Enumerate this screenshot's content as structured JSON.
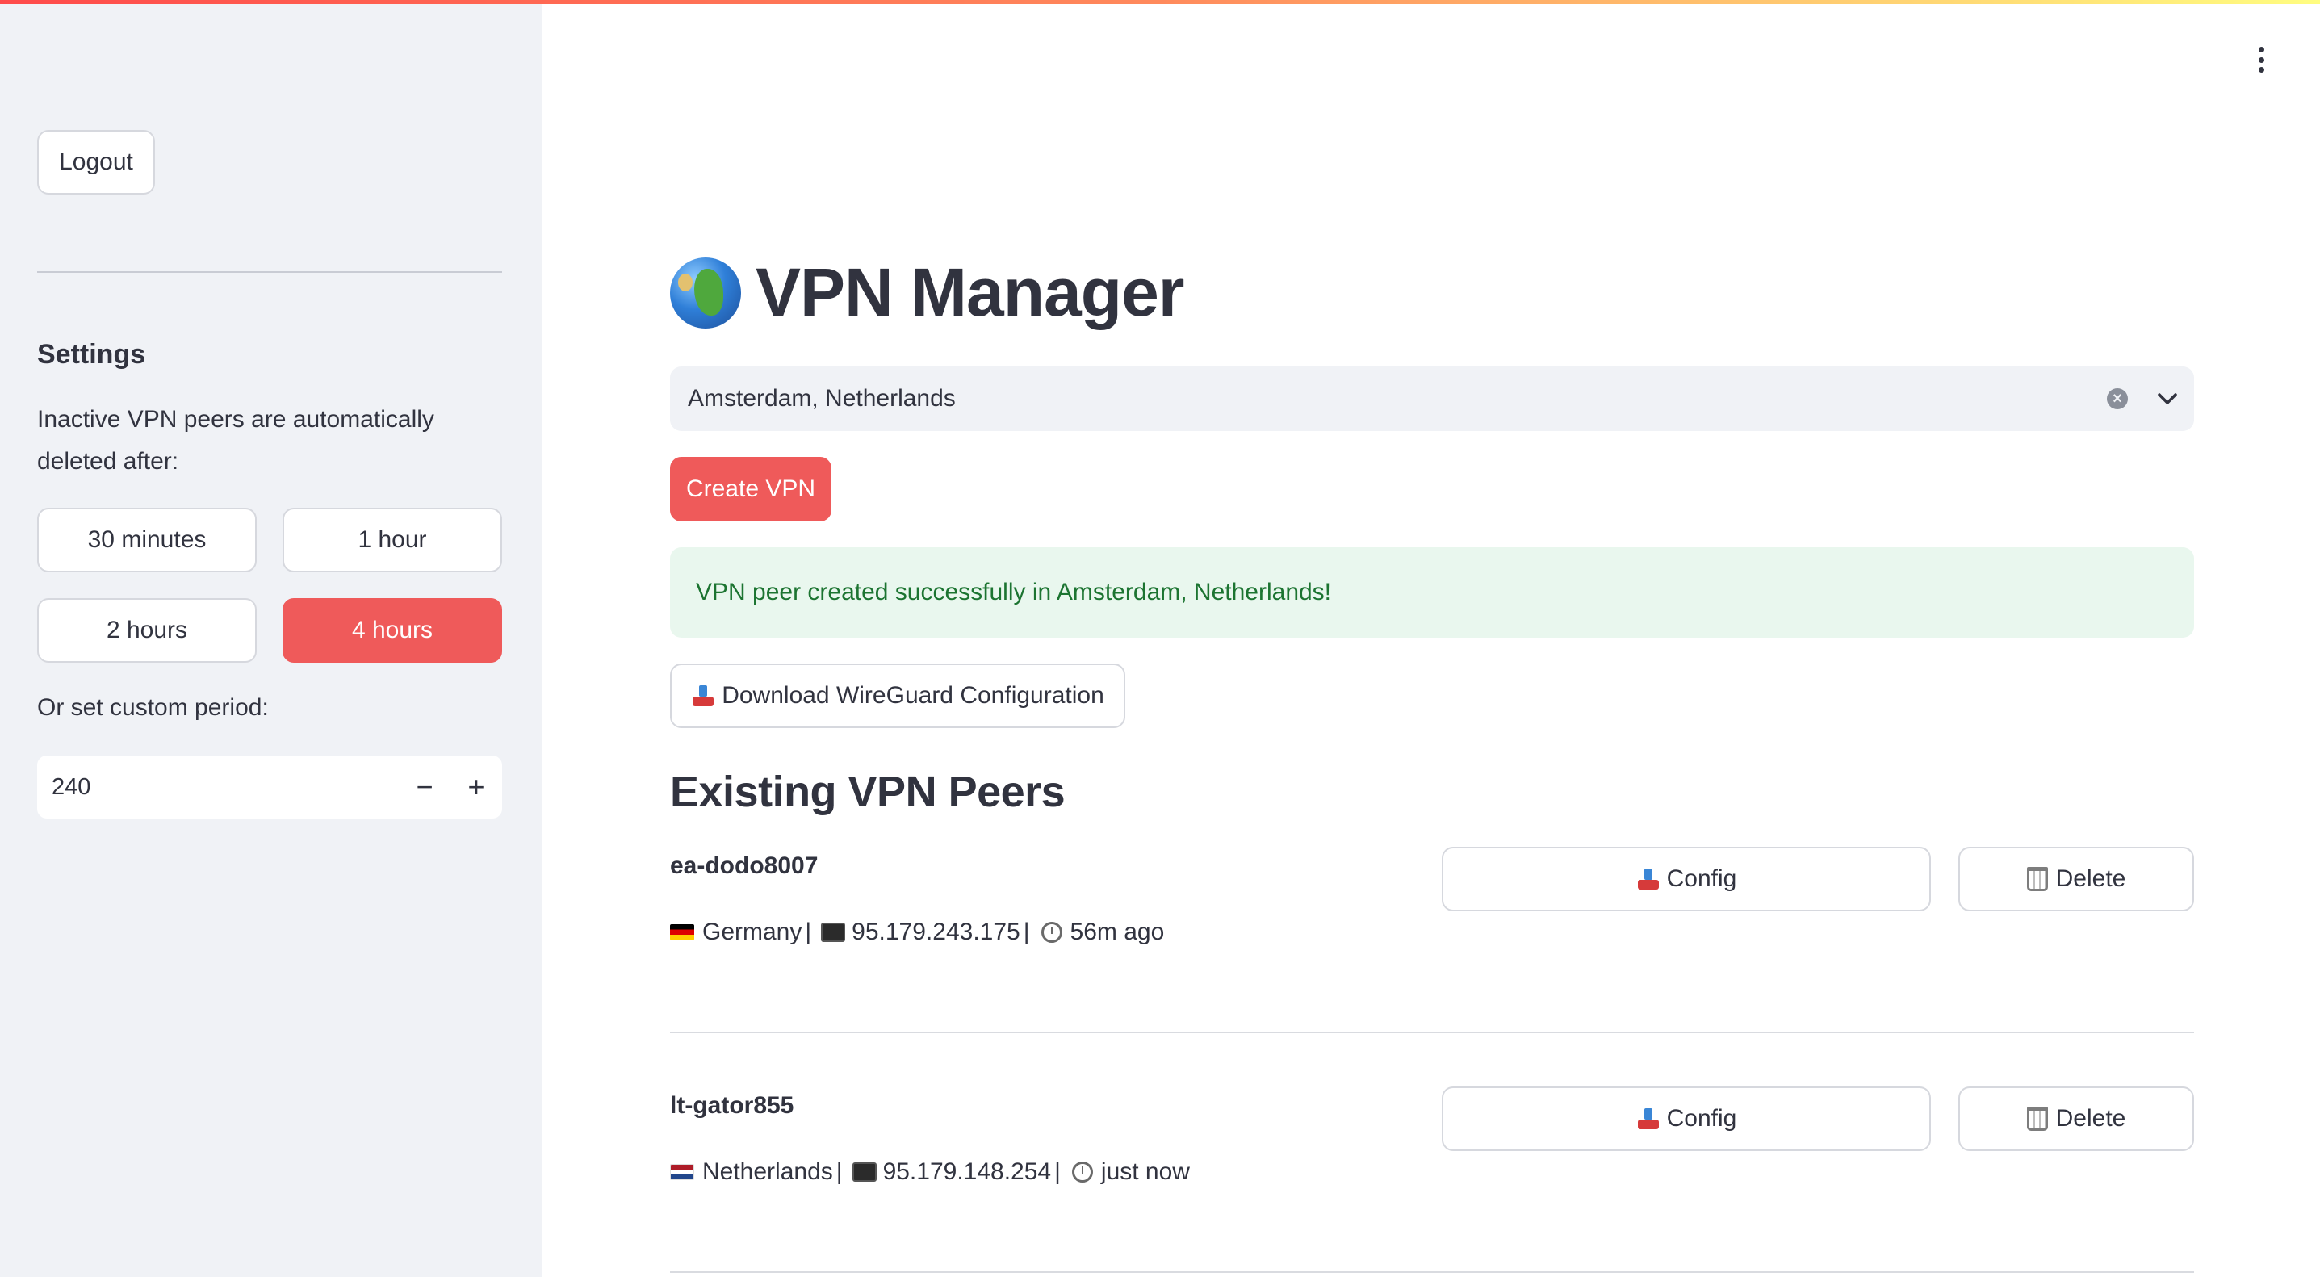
{
  "sidebar": {
    "logout_label": "Logout",
    "settings_title": "Settings",
    "settings_desc": "Inactive VPN peers are automatically deleted after:",
    "periods": [
      "30 minutes",
      "1 hour",
      "2 hours",
      "4 hours"
    ],
    "active_period": "4 hours",
    "custom_label": "Or set custom period:",
    "custom_value": "240",
    "decrement": "−",
    "increment": "+"
  },
  "main": {
    "title": "VPN Manager",
    "location_select": {
      "value": "Amsterdam, Netherlands",
      "clear": "×"
    },
    "create_label": "Create VPN",
    "success_message": "VPN peer created successfully in Amsterdam, Netherlands!",
    "download_label": "Download WireGuard Configuration",
    "peers_title": "Existing VPN Peers",
    "peers": [
      {
        "name": "ea-dodo8007",
        "country": "Germany",
        "ip": "95.179.243.175",
        "age": "56m ago",
        "config_label": "Config",
        "delete_label": "Delete"
      },
      {
        "name": "lt-gator855",
        "country": "Netherlands",
        "ip": "95.179.148.254",
        "age": "just now",
        "config_label": "Config",
        "delete_label": "Delete"
      }
    ],
    "separator": "|"
  },
  "colors": {
    "accent": "#ef5a5a",
    "sidebar_bg": "#f0f2f6",
    "success_bg": "#e9f7ee",
    "success_text": "#1c7431",
    "text": "#31333f"
  }
}
